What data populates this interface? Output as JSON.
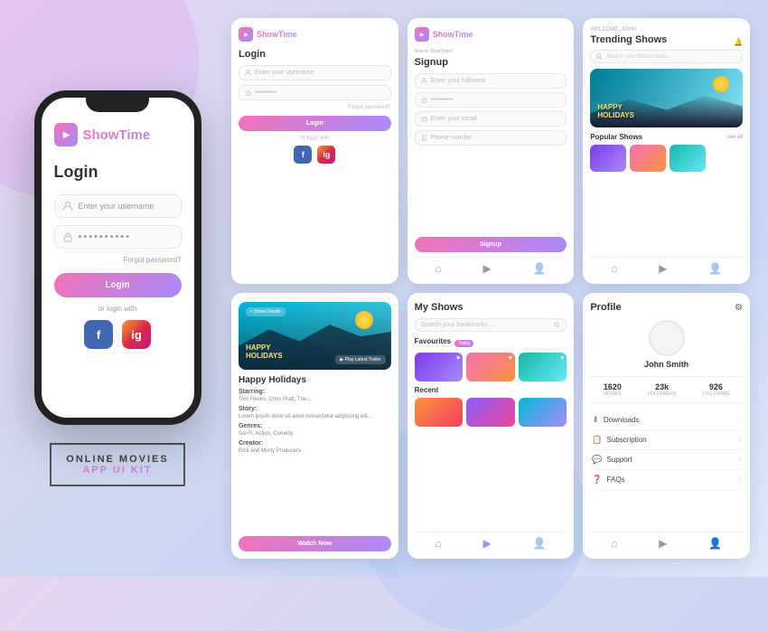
{
  "app": {
    "name": "ShowTime",
    "tagline": "ONLINE MOVIES APP UI KIT"
  },
  "phone": {
    "brand": "ShowTime",
    "login_title": "Login",
    "username_placeholder": "Enter your username",
    "password_dots": "••••••••••",
    "forgot_password": "Forgot password?",
    "login_btn": "Login",
    "or_login_with": "or login with",
    "facebook": "f",
    "instagram": "ig"
  },
  "brand_label": {
    "line1": "ONLINE MOVIES",
    "line2": "APP",
    "highlighted": "UI KIT"
  },
  "screens": {
    "login": {
      "title": "Login",
      "username_placeholder": "Enter your username",
      "password_placeholder": "••••••••••",
      "forgot": "Forgot password?",
      "login_btn": "Login",
      "or_text": "or login with"
    },
    "signup": {
      "title": "Signup",
      "fullname_placeholder": "Enter your fullname",
      "password_placeholder": "••••••••••",
      "email_placeholder": "Enter your email",
      "phone_placeholder": "Phone number",
      "signup_btn": "Signup"
    },
    "trending": {
      "welcome": "WELCOME, JOHN",
      "title": "Trending Shows",
      "search_placeholder": "Search your Shows here...",
      "hero_text1": "HAPPY",
      "hero_text2": "HOLIDAYS",
      "popular_title": "Popular Shows",
      "see_all": "see all"
    },
    "movie_detail": {
      "show_details": "< Show Details",
      "title": "Happy Holidays",
      "starring_label": "Starring:",
      "starring_val": "Tom Hanks, Chris Pratt, The...",
      "story_label": "Story:",
      "story_val": "Lorem ipsum dolor sit amet consectetur adipiscing elit...",
      "genres_label": "Genres:",
      "genres_val": "Sci-Fi, Action, Comedy",
      "creator_label": "Creator:",
      "creator_val": "Rick and Morty Producers",
      "play_trailer": "▶ Play Latest Trailer",
      "watch_now": "Watch Now"
    },
    "my_shows": {
      "title": "My Shows",
      "search_placeholder": "Search your bookmarks...",
      "favourites_label": "Favourites",
      "favourites_tag": "Today",
      "recent_label": "Recent"
    },
    "profile": {
      "title": "Profile",
      "name": "John Smith",
      "stat1_val": "1620",
      "stat1_label": "Movies",
      "stat2_val": "23k",
      "stat2_label": "Followers",
      "stat3_val": "926",
      "stat3_label": "Following",
      "menu": [
        {
          "icon": "⬇",
          "label": "Downloads"
        },
        {
          "icon": "📋",
          "label": "Subscription"
        },
        {
          "icon": "💬",
          "label": "Support"
        },
        {
          "icon": "❓",
          "label": "FAQs"
        }
      ]
    }
  }
}
